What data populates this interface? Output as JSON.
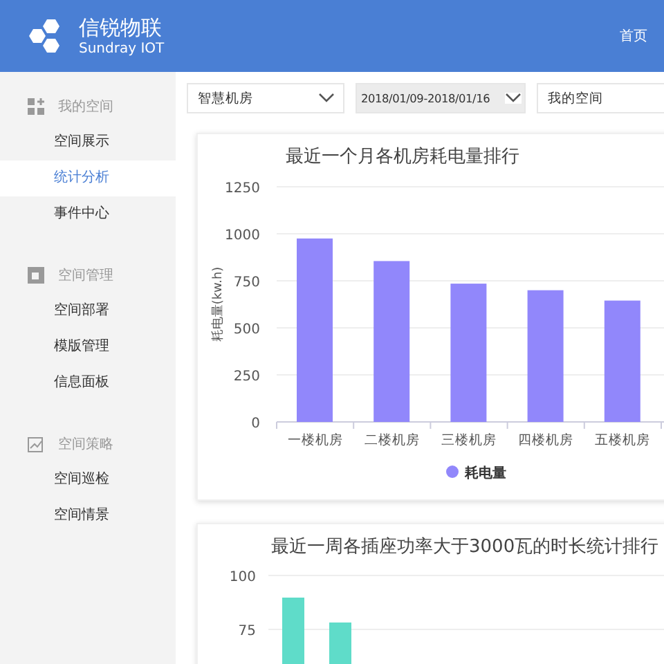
{
  "header": {
    "brand": "信锐物联",
    "brand_sub": "Sundray IOT",
    "nav": [
      {
        "label": "首页"
      }
    ]
  },
  "sidebar": {
    "groups": [
      {
        "title": "我的空间",
        "items": [
          {
            "label": "空间展示",
            "selected": false
          },
          {
            "label": "统计分析",
            "selected": true
          },
          {
            "label": "事件中心",
            "selected": false
          }
        ]
      },
      {
        "title": "空间管理",
        "items": [
          {
            "label": "空间部署",
            "selected": false
          },
          {
            "label": "模版管理",
            "selected": false
          },
          {
            "label": "信息面板",
            "selected": false
          }
        ]
      },
      {
        "title": "空间策略",
        "items": [
          {
            "label": "空间巡检",
            "selected": false
          },
          {
            "label": "空间情景",
            "selected": false
          }
        ]
      }
    ]
  },
  "filters": [
    {
      "value": "智慧机房",
      "active": false,
      "caret": true
    },
    {
      "value": "2018/01/09-2018/01/16",
      "active": true,
      "caret": true
    },
    {
      "value": "我的空间",
      "active": false,
      "caret": false
    }
  ],
  "charts": [
    {
      "chart_data": {
        "type": "bar",
        "title": "最近一个月各机房耗电量排行",
        "ylabel": "耗电量(kw.h)",
        "categories": [
          "一楼机房",
          "二楼机房",
          "三楼机房",
          "四楼机房",
          "五楼机房"
        ],
        "series": [
          {
            "name": "耗电量",
            "color": "#9187fb",
            "values": [
              975,
              855,
              735,
              700,
              645
            ]
          }
        ],
        "ylim": [
          0,
          1250
        ],
        "yticks": [
          0,
          250,
          500,
          750,
          1000,
          1250
        ],
        "grid": true
      }
    },
    {
      "title": "最近一周各插座功率大于3000瓦的时长统计排行",
      "y_tick_labels": [
        "100",
        "75"
      ]
    }
  ]
}
